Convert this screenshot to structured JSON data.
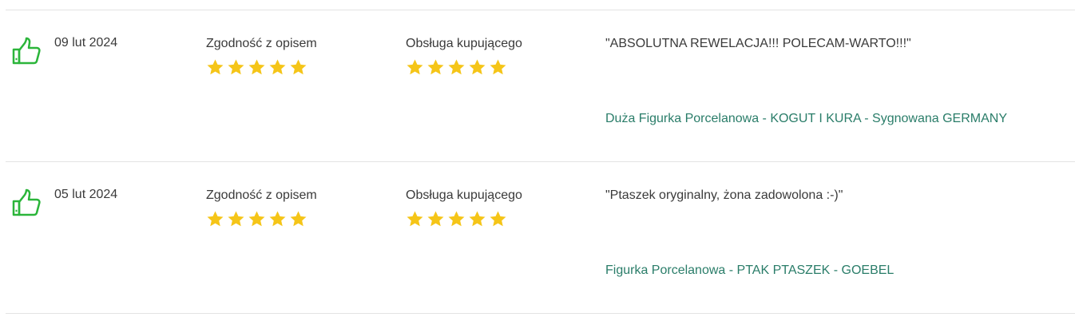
{
  "reviews": [
    {
      "rating_type": "positive",
      "icon": "thumbs-up-icon",
      "date": "09 lut 2024",
      "ratings": [
        {
          "label": "Zgodność z opisem",
          "stars": 5,
          "max": 5
        },
        {
          "label": "Obsługa kupującego",
          "stars": 5,
          "max": 5
        }
      ],
      "comment": "\"ABSOLUTNA REWELACJA!!! POLECAM-WARTO!!!\"",
      "offer_title": "Duża Figurka Porcelanowa - KOGUT I KURA - Sygnowana GERMANY"
    },
    {
      "rating_type": "positive",
      "icon": "thumbs-up-icon",
      "date": "05 lut 2024",
      "ratings": [
        {
          "label": "Zgodność z opisem",
          "stars": 5,
          "max": 5
        },
        {
          "label": "Obsługa kupującego",
          "stars": 5,
          "max": 5
        }
      ],
      "comment": "\"Ptaszek oryginalny, żona zadowolona :-)\"",
      "offer_title": "Figurka Porcelanowa - PTAK PTASZEK - GOEBEL"
    }
  ],
  "colors": {
    "thumb_green": "#2bb53a",
    "star_yellow": "#f5c518",
    "link_teal": "#2a7d69",
    "text": "#3a3a3a",
    "divider": "#e3e3e3"
  }
}
